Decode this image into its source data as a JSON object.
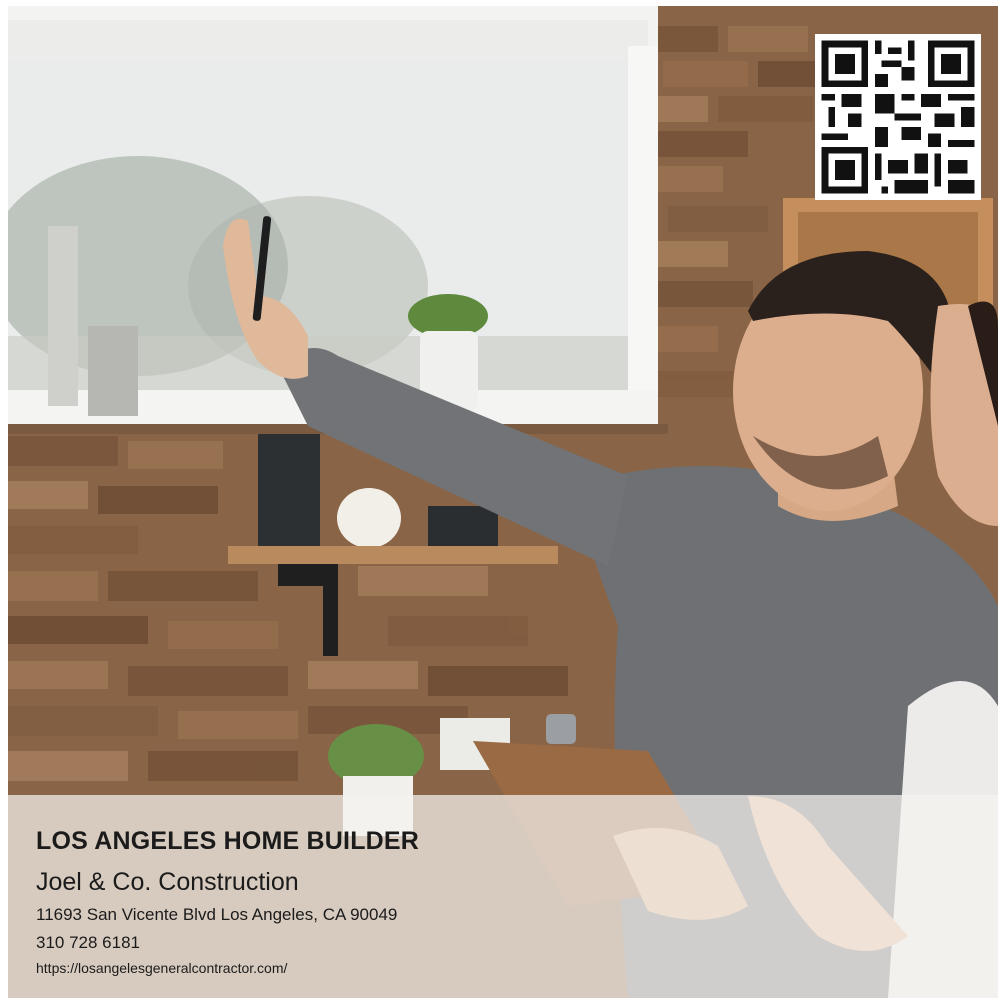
{
  "caption": {
    "title": "LOS ANGELES HOME BUILDER",
    "company": "Joel & Co. Construction",
    "address": "11693 San Vicente Blvd Los Angeles, CA 90049",
    "phone": "310 728 6181",
    "url": "https://losangelesgeneralcontractor.com/"
  },
  "colors": {
    "brick": "#8a6446",
    "sweater": "#6e7073",
    "window_light": "#eef0ee",
    "caption_overlay": "#f5f3ef"
  }
}
